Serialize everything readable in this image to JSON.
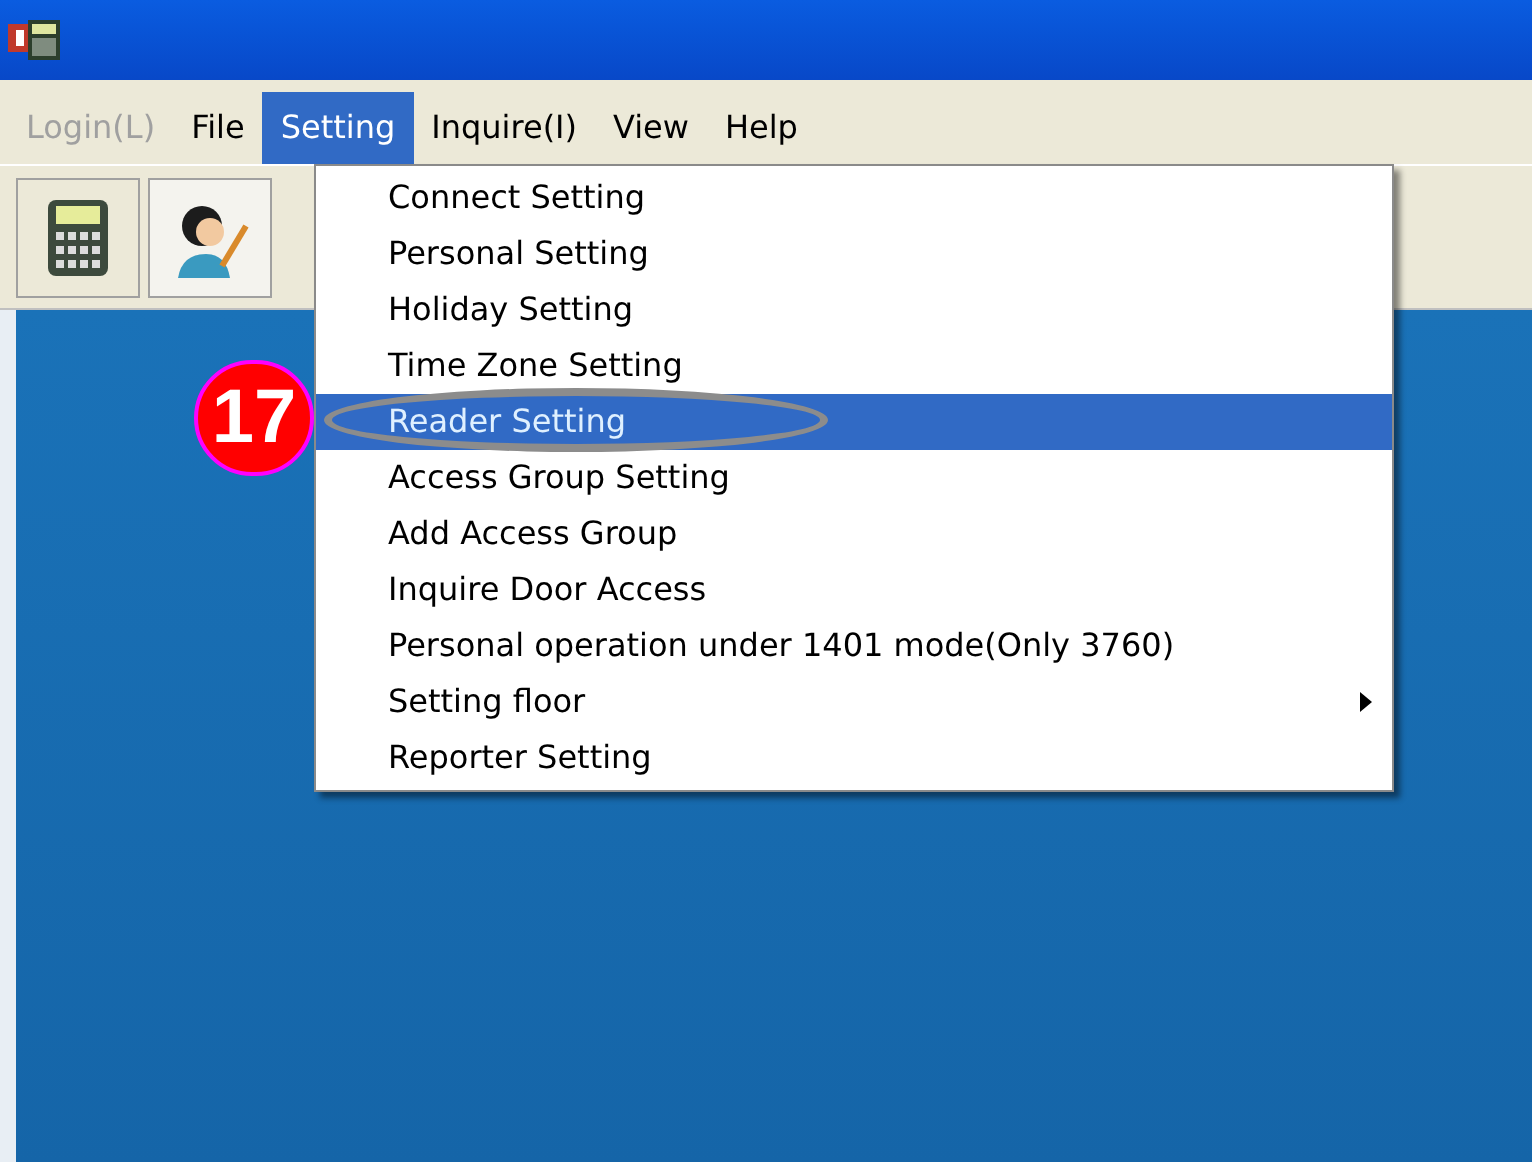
{
  "menu_bar": [
    {
      "label": "Login(L)",
      "disabled": true,
      "selected": false
    },
    {
      "label": "File",
      "disabled": false,
      "selected": false
    },
    {
      "label": "Setting",
      "disabled": false,
      "selected": true
    },
    {
      "label": "Inquire(I)",
      "disabled": false,
      "selected": false
    },
    {
      "label": "View",
      "disabled": false,
      "selected": false
    },
    {
      "label": "Help",
      "disabled": false,
      "selected": false
    }
  ],
  "dropdown": [
    {
      "label": "Connect Setting",
      "selected": false,
      "submenu": false
    },
    {
      "label": "Personal Setting",
      "selected": false,
      "submenu": false
    },
    {
      "label": "Holiday Setting",
      "selected": false,
      "submenu": false
    },
    {
      "label": "Time Zone Setting",
      "selected": false,
      "submenu": false
    },
    {
      "label": "Reader Setting",
      "selected": true,
      "submenu": false
    },
    {
      "label": "Access Group Setting",
      "selected": false,
      "submenu": false
    },
    {
      "label": "Add Access Group",
      "selected": false,
      "submenu": false
    },
    {
      "label": "Inquire Door Access",
      "selected": false,
      "submenu": false
    },
    {
      "label": "Personal operation under 1401 mode(Only 3760)",
      "selected": false,
      "submenu": false
    },
    {
      "label": "Setting floor",
      "selected": false,
      "submenu": true
    },
    {
      "label": "Reporter Setting",
      "selected": false,
      "submenu": false
    }
  ],
  "callout": {
    "number": "17"
  }
}
